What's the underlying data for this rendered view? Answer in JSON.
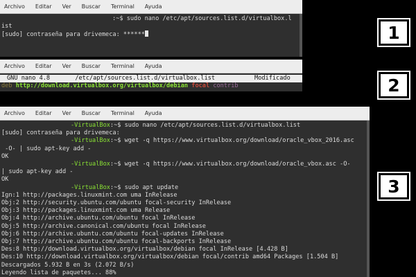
{
  "menu": [
    "Archivo",
    "Editar",
    "Ver",
    "Buscar",
    "Terminal",
    "Ayuda"
  ],
  "badges": [
    "1",
    "2",
    "3"
  ],
  "panel1": {
    "lines": [
      {
        "prompt_host": "",
        "text": ":~$ sudo nano /etc/apt/sources.list.d/virtualbox.l"
      },
      {
        "prompt_host": "",
        "text": "ist"
      },
      {
        "prompt_host": "",
        "text": "[sudo] contraseña para drivemeca: ******"
      }
    ]
  },
  "panel2": {
    "nano_title": "GNU nano 4.8",
    "nano_file": "/etc/apt/sources.list.d/virtualbox.list",
    "nano_status": "Modificado",
    "deb_key": "deb",
    "deb_url": "http://download.virtualbox.org/virtualbox/debian",
    "deb_dist": "focal",
    "deb_comp": "contrib"
  },
  "panel3": {
    "lines": [
      {
        "host": "-VirtualBox",
        "text": ":~$ sudo nano /etc/apt/sources.list.d/virtualbox.list"
      },
      {
        "host": "",
        "text": "[sudo] contraseña para drivemeca:"
      },
      {
        "host": "-VirtualBox",
        "text": ":~$ wget -q https://www.virtualbox.org/download/oracle_vbox_2016.asc"
      },
      {
        "host": "",
        "text": " -O- | sudo apt-key add -"
      },
      {
        "host": "",
        "text": "OK"
      },
      {
        "host": "-VirtualBox",
        "text": ":~$ wget -q https://www.virtualbox.org/download/oracle_vbox.asc -O-"
      },
      {
        "host": "",
        "text": "| sudo apt-key add -"
      },
      {
        "host": "",
        "text": "OK"
      },
      {
        "host": "-VirtualBox",
        "text": ":~$ sudo apt update"
      },
      {
        "host": "",
        "text": "Ign:1 http://packages.linuxmint.com uma InRelease"
      },
      {
        "host": "",
        "text": "Obj:2 http://security.ubuntu.com/ubuntu focal-security InRelease"
      },
      {
        "host": "",
        "text": "Obj:3 http://packages.linuxmint.com uma Release"
      },
      {
        "host": "",
        "text": "Obj:4 http://archive.ubuntu.com/ubuntu focal InRelease"
      },
      {
        "host": "",
        "text": "Obj:5 http://archive.canonical.com/ubuntu focal InRelease"
      },
      {
        "host": "",
        "text": "Obj:6 http://archive.ubuntu.com/ubuntu focal-updates InRelease"
      },
      {
        "host": "",
        "text": "Obj:7 http://archive.ubuntu.com/ubuntu focal-backports InRelease"
      },
      {
        "host": "",
        "text": "Des:8 http://download.virtualbox.org/virtualbox/debian focal InRelease [4.428 B]"
      },
      {
        "host": "",
        "text": "Des:10 http://download.virtualbox.org/virtualbox/debian focal/contrib amd64 Packages [1.504 B]"
      },
      {
        "host": "",
        "text": "Descargados 5.932 B en 3s (2.072 B/s)"
      },
      {
        "host": "",
        "text": "Leyendo lista de paquetes... 88%"
      }
    ]
  },
  "colors": {
    "prompt_green": "#8ae234",
    "terminal_bg": "#2f2f2f",
    "menubar_bg": "#ededed"
  }
}
